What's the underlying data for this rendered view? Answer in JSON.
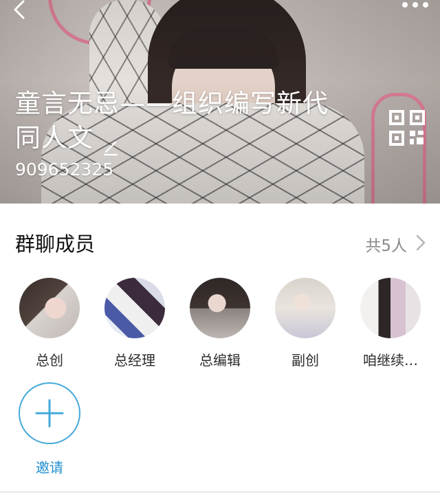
{
  "header": {
    "title": "童言无忌——组织编写新代同人文",
    "group_number": "909652325",
    "back_icon": "chevron-left-icon",
    "more_icon": "more-dots-icon",
    "edit_icon": "pencil-icon",
    "qr_icon": "qr-code-icon"
  },
  "members": {
    "title": "群聊成员",
    "count_label": "共5人",
    "chevron_icon": "chevron-right-icon",
    "items": [
      {
        "name": "总创"
      },
      {
        "name": "总经理"
      },
      {
        "name": "总编辑"
      },
      {
        "name": "副创"
      },
      {
        "name": "咱继续…"
      }
    ],
    "invite_label": "邀请",
    "invite_icon": "plus-icon"
  },
  "colors": {
    "accent": "#45a9d9",
    "invite_text": "#1f8fcf",
    "secondary_text": "#8a8a8a"
  }
}
